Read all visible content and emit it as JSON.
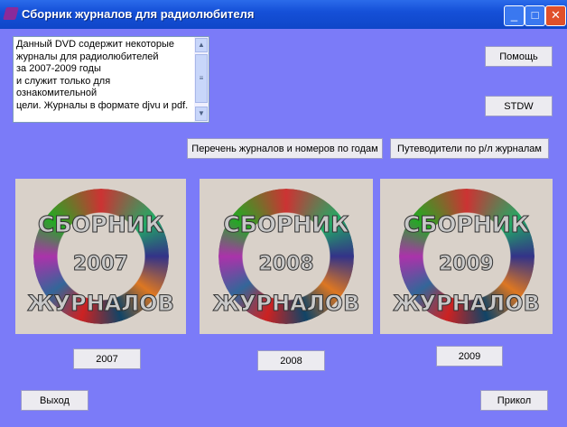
{
  "window": {
    "title": "Сборник журналов для радиолюбителя",
    "minimize": "_",
    "maximize": "□",
    "close": "✕"
  },
  "memo": {
    "lines": [
      "Данный DVD содержит некоторые",
      "журналы для радиолюбителей",
      "за 2007-2009 годы",
      "и служит только для",
      "ознакомительной",
      "цели. Журналы в формате djvu и pdf."
    ]
  },
  "buttons": {
    "help": "Помощь",
    "stdw": "STDW",
    "list": "Перечень журналов и номеров по годам",
    "guides": "Путеводители по р/л журналам",
    "y2007": "2007",
    "y2008": "2008",
    "y2009": "2009",
    "exit": "Выход",
    "joke": "Прикол"
  },
  "covers": [
    {
      "top": "СБОРНИК",
      "year": "2007",
      "bottom": "ЖУРНАЛОВ"
    },
    {
      "top": "СБОРНИК",
      "year": "2008",
      "bottom": "ЖУРНАЛОВ"
    },
    {
      "top": "СБОРНИК",
      "year": "2009",
      "bottom": "ЖУРНАЛОВ"
    }
  ]
}
